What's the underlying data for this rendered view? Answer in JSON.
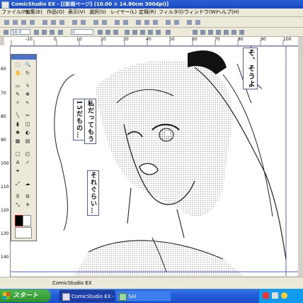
{
  "window": {
    "title": "ComicStudio EX - [[新規ページ] (10.00 × 14.80cm 300dpi)]"
  },
  "menu": [
    "ファイル(F)",
    "編集(E)",
    "作品(O)",
    "表示(V)",
    "選択(S)",
    "レイヤー(L)",
    "定規(R)",
    "フィルタ(I)",
    "ウィンドウ(W)",
    "ヘルプ(H)"
  ],
  "toolbar2": {
    "zoom_value": "50.0",
    "angle_value": "0"
  },
  "ruler": {
    "h_labels": [
      "-10",
      "0",
      "10",
      "20",
      "30",
      "40",
      "50",
      "60",
      "70",
      "80",
      "90",
      "100"
    ],
    "v_labels": [
      "60",
      "70",
      "80",
      "90",
      "100",
      "110",
      "120",
      "130",
      "140"
    ]
  },
  "balloons": {
    "top_right": "そ、そうよ",
    "left_col1": "私だってもう",
    "left_col2": "15だもの…",
    "middle": "それぐらい…"
  },
  "statusbar": {
    "text": "ComicStudio EX"
  },
  "taskbar": {
    "start_label": "スタート",
    "tasks": [
      "ComicStudio EX - [[...",
      "SAI"
    ]
  },
  "colors": {
    "title_bar": "#1c49c0",
    "taskbar": "#245edb",
    "start_button": "#2f8f2f",
    "balloon_border": "#5060a8"
  }
}
